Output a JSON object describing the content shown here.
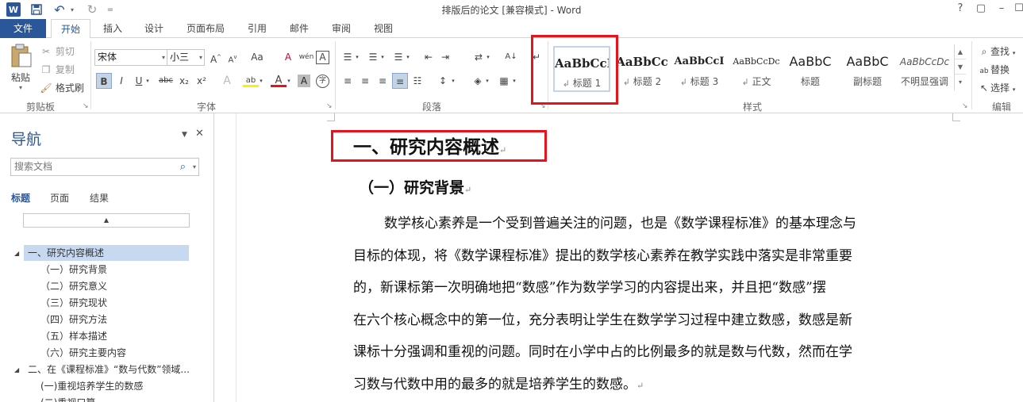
{
  "window": {
    "title": "排版后的论文 [兼容模式] - Word",
    "help": "?",
    "controls": [
      "▢",
      "–",
      "☐",
      "✕"
    ]
  },
  "quick_access": {
    "app_icon": "W",
    "save_icon": "save-icon",
    "undo": "↶",
    "redo": "↻",
    "customize": "="
  },
  "tabs": [
    {
      "label": "文件"
    },
    {
      "label": "开始"
    },
    {
      "label": "插入"
    },
    {
      "label": "设计"
    },
    {
      "label": "页面布局"
    },
    {
      "label": "引用"
    },
    {
      "label": "邮件"
    },
    {
      "label": "审阅"
    },
    {
      "label": "视图"
    }
  ],
  "clipboard": {
    "group": "剪贴板",
    "paste": "粘贴",
    "cut": "剪切",
    "copy": "复制",
    "format_painter": "格式刷"
  },
  "font": {
    "group": "字体",
    "family": "宋体",
    "size": "小三",
    "grow": "A˄",
    "shrink": "A˅",
    "case": "Aa",
    "clear": "A",
    "phonetic": "wén",
    "border_char": "A",
    "bold": "B",
    "italic": "I",
    "underline": "U",
    "strike": "abc",
    "sub": "x₂",
    "sup": "x²",
    "effects": "A",
    "highlight": "ab",
    "color": "A",
    "shading": "A",
    "enclose": "字"
  },
  "paragraph": {
    "group": "段落"
  },
  "styles": {
    "group": "样式",
    "items": [
      {
        "sample": "AaBbCcI",
        "name": "标题 1"
      },
      {
        "sample": "AaBbCc",
        "name": "标题 2"
      },
      {
        "sample": "AaBbCcI",
        "name": "标题 3"
      },
      {
        "sample": "AaBbCcDc",
        "name": "正文"
      },
      {
        "sample": "AaBbC",
        "name": "标题"
      },
      {
        "sample": "AaBbC",
        "name": "副标题"
      },
      {
        "sample": "AaBbCcDc",
        "name": "不明显强调"
      }
    ]
  },
  "editing": {
    "group": "编辑",
    "find": "查找",
    "replace": "替换",
    "select": "选择"
  },
  "nav": {
    "title": "导航",
    "search_placeholder": "搜索文档",
    "tabs": [
      "标题",
      "页面",
      "结果"
    ],
    "outline": [
      {
        "text": "一、研究内容概述"
      },
      {
        "text": "（一）研究背景"
      },
      {
        "text": "（二）研究意义"
      },
      {
        "text": "（三）研究现状"
      },
      {
        "text": "（四）研究方法"
      },
      {
        "text": "（五）样本描述"
      },
      {
        "text": "（六）研究主要内容"
      },
      {
        "text": "二、在《课程标准》“数与代数”领域..."
      },
      {
        "text": "(一)重视培养学生的数感"
      },
      {
        "text": "(二)重视口算"
      }
    ]
  },
  "document": {
    "heading1": "一、研究内容概述",
    "heading2": "（一）研究背景",
    "paragraph_lines": [
      "数学核心素养是一个受到普遍关注的问题，也是《数学课程标准》的基本理念与",
      "目标的体现，将《数学课程标准》提出的数学核心素养在教学实践中落实是非常重要",
      "的，新课标第一次明确地把“数感”作为数学学习的内容提出来，并且把“数感”摆",
      "在六个核心概念中的第一位，充分表明让学生在数学学习过程中建立数感，数感是新",
      "课标十分强调和重视的问题。同时在小学中占的比例最多的就是数与代数，然而在学",
      "习数与代数中用的最多的就是培养学生的数感。"
    ],
    "para_mark": "↵"
  }
}
